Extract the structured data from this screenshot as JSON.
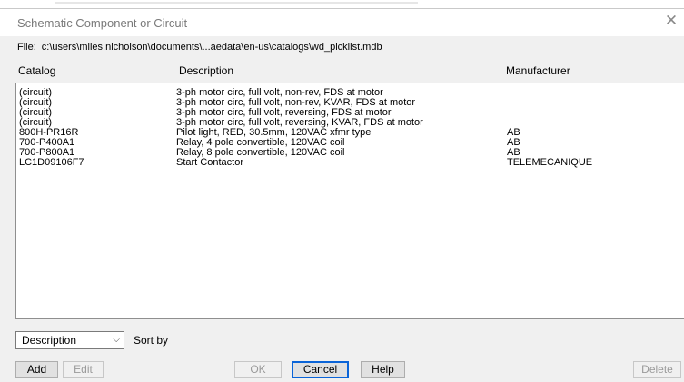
{
  "window": {
    "title": "Schematic Component or Circuit",
    "close_glyph": "✕"
  },
  "file": {
    "label": "File:",
    "path": "c:\\users\\miles.nicholson\\documents\\...aedata\\en-us\\catalogs\\wd_picklist.mdb"
  },
  "columns": {
    "catalog": "Catalog",
    "description": "Description",
    "manufacturer": "Manufacturer"
  },
  "rows": [
    {
      "catalog": "(circuit)",
      "description": "3-ph motor circ, full volt, non-rev, FDS at motor",
      "manufacturer": ""
    },
    {
      "catalog": "(circuit)",
      "description": "3-ph motor circ, full volt, non-rev, KVAR, FDS at motor",
      "manufacturer": ""
    },
    {
      "catalog": "(circuit)",
      "description": "3-ph motor circ, full volt, reversing, FDS at motor",
      "manufacturer": ""
    },
    {
      "catalog": "(circuit)",
      "description": "3-ph motor circ, full volt, reversing, KVAR, FDS at motor",
      "manufacturer": ""
    },
    {
      "catalog": "800H-PR16R",
      "description": "Pilot light, RED, 30.5mm, 120VAC xfmr type",
      "manufacturer": "AB"
    },
    {
      "catalog": "700-P400A1",
      "description": "Relay, 4 pole convertible, 120VAC coil",
      "manufacturer": "AB"
    },
    {
      "catalog": "700-P800A1",
      "description": "Relay, 8 pole convertible, 120VAC coil",
      "manufacturer": "AB"
    },
    {
      "catalog": "LC1D09106F7",
      "description": "Start Contactor",
      "manufacturer": "TELEMECANIQUE"
    }
  ],
  "sort": {
    "selected": "Description",
    "label": "Sort by",
    "chevron": "⌵"
  },
  "buttons": {
    "add": "Add",
    "edit": "Edit",
    "ok": "OK",
    "cancel": "Cancel",
    "help": "Help",
    "delete": "Delete"
  }
}
